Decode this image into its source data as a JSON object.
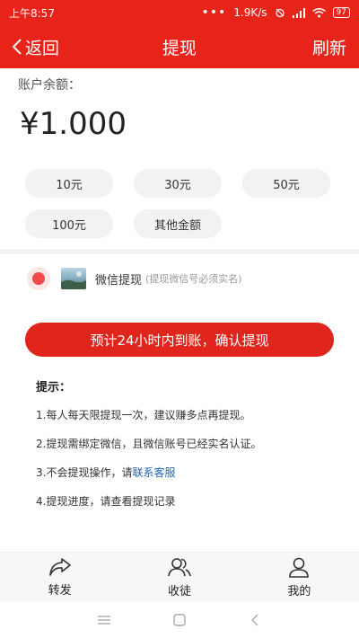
{
  "status_bar": {
    "time": "上午8:57",
    "dots": "•••",
    "speed": "1.9K/s",
    "battery": "97"
  },
  "nav": {
    "back_label": "返回",
    "title": "提现",
    "refresh_label": "刷新"
  },
  "balance": {
    "label": "账户余额：",
    "value": "¥1.000"
  },
  "amount_options": [
    "10元",
    "30元",
    "50元",
    "100元",
    "其他金额"
  ],
  "method": {
    "title": "微信提现",
    "note": "(提现微信号必须实名)",
    "selected": true
  },
  "confirm_label": "预计24小时内到账，确认提现",
  "tips": {
    "title": "提示：",
    "items": [
      "1.每人每天限提现一次，建议赚多点再提现。",
      "2.提现需绑定微信，且微信账号已经实名认证。",
      "3.不会提现操作，请",
      "4.提现进度，请查看提现记录"
    ],
    "link": "联系客服"
  },
  "tabbar": [
    {
      "label": "转发",
      "icon": "share-icon"
    },
    {
      "label": "收徒",
      "icon": "apprentice-icon"
    },
    {
      "label": "我的",
      "icon": "profile-icon"
    }
  ],
  "colors": {
    "brand_red": "#e8241a",
    "link_blue": "#2463b8"
  }
}
